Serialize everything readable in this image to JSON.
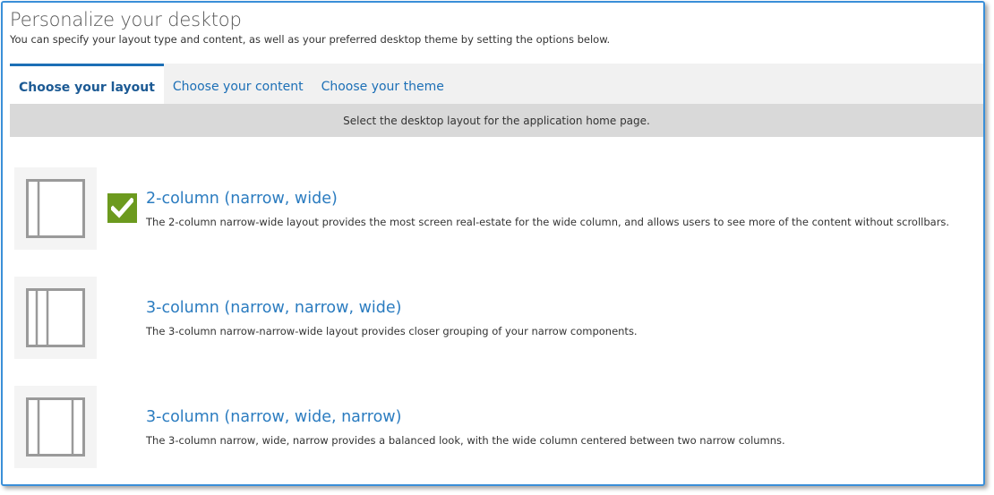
{
  "header": {
    "title": "Personalize your desktop",
    "subtitle": "You can specify your layout type and content, as well as your preferred desktop theme by setting the options below."
  },
  "tabs": [
    {
      "label": "Choose your layout",
      "active": true
    },
    {
      "label": "Choose your content",
      "active": false
    },
    {
      "label": "Choose your theme",
      "active": false
    }
  ],
  "info_bar": {
    "text": "Select the desktop layout for the application home page."
  },
  "layouts": [
    {
      "title": "2-column (narrow, wide)",
      "description": "The 2-column narrow-wide layout provides the most screen real-estate for the wide column, and allows users to see more of the content without scrollbars.",
      "selected": true,
      "icon": "two-column-layout-icon"
    },
    {
      "title": "3-column (narrow, narrow, wide)",
      "description": "The 3-column narrow-narrow-wide layout provides closer grouping of your narrow components.",
      "selected": false,
      "icon": "three-column-nnw-layout-icon"
    },
    {
      "title": "3-column (narrow, wide, narrow)",
      "description": "The 3-column narrow, wide, narrow provides a balanced look, with the wide column centered between two narrow columns.",
      "selected": false,
      "icon": "three-column-nwn-layout-icon"
    }
  ],
  "colors": {
    "accent": "#1c6fb6",
    "link": "#2b7cc0",
    "check": "#6c9a1e",
    "frame_border": "#3a8fd8"
  }
}
